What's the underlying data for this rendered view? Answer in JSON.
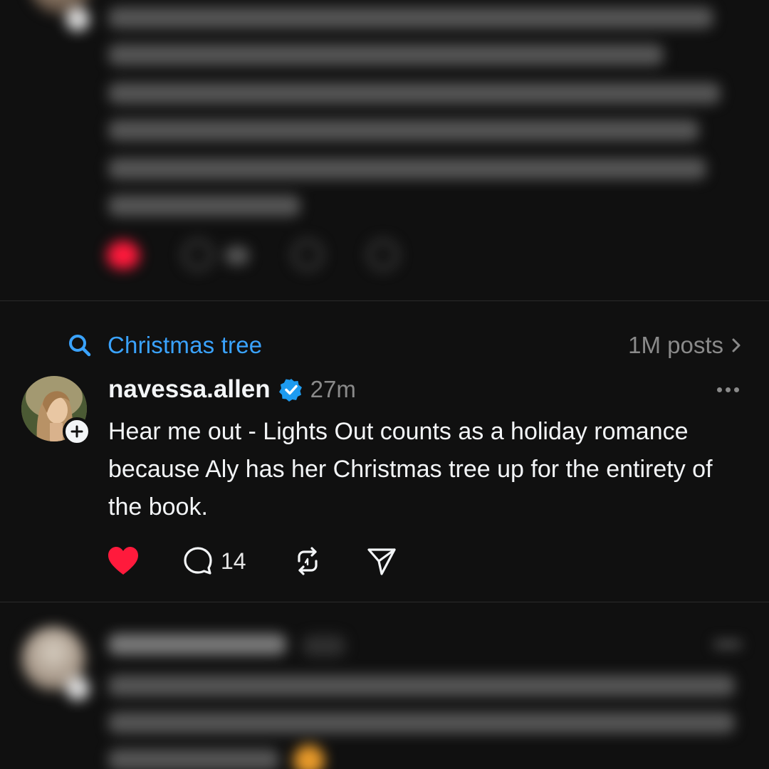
{
  "topic": {
    "label": "Christmas tree",
    "post_count": "1M posts",
    "search_icon": "search-icon",
    "chevron_icon": "chevron-right-icon",
    "accent_color": "#3aa3ff"
  },
  "post": {
    "username": "navessa.allen",
    "verified": true,
    "timestamp": "27m",
    "text": "Hear me out - Lights Out counts as a holiday romance because Aly has her Christmas tree up for the entirety of the book.",
    "liked": true,
    "like_color": "#ff1a3c",
    "reply_count": "14",
    "icons": [
      "heart-icon",
      "comment-icon",
      "repost-icon",
      "share-icon",
      "more-icon"
    ]
  },
  "theme": {
    "background": "#101010",
    "text": "#f3f5f7",
    "secondary_text": "#8a8a8a",
    "verified_color": "#1d9bf0"
  }
}
